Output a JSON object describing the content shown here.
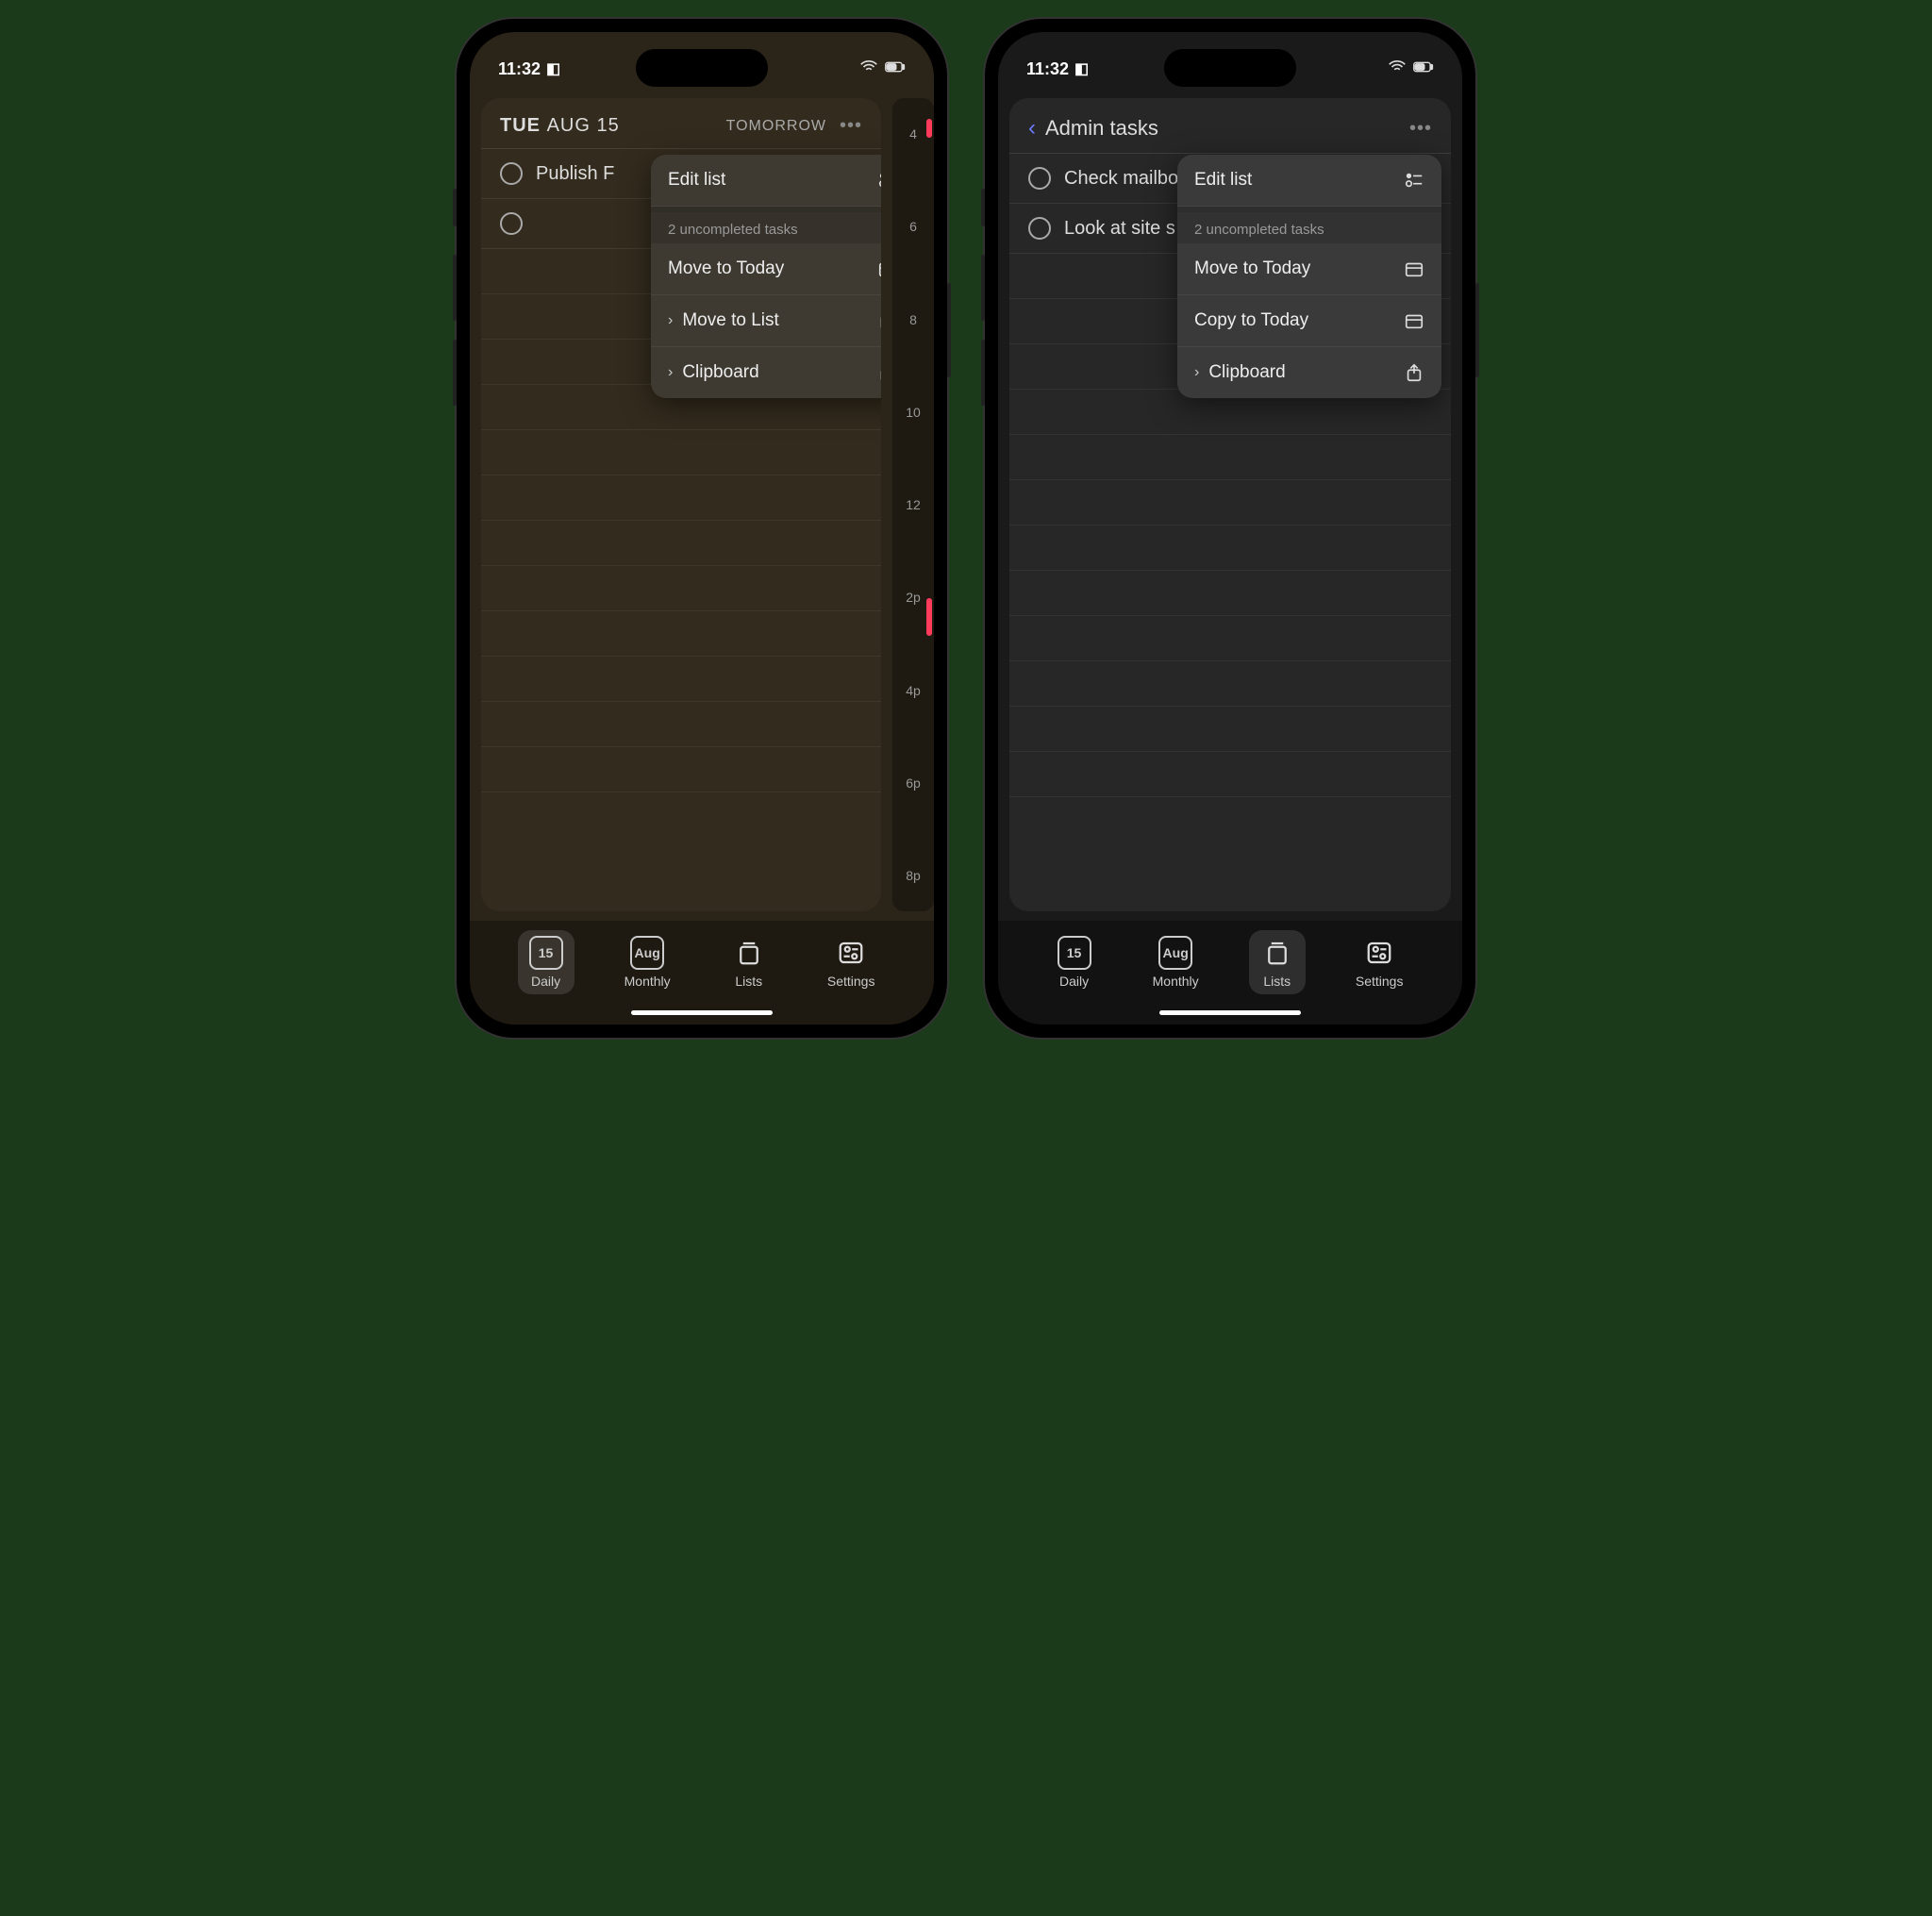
{
  "status": {
    "time": "11:32"
  },
  "left": {
    "header": {
      "day": "TUE",
      "date": "AUG 15",
      "tomorrow": "TOMORROW"
    },
    "tasks": [
      {
        "label": "Publish F"
      },
      {
        "label": ""
      }
    ],
    "timeline": [
      "4",
      "6",
      "8",
      "10",
      "12",
      "2p",
      "4p",
      "6p",
      "8p"
    ],
    "menu": {
      "edit": "Edit list",
      "subheader": "2 uncompleted tasks",
      "moveToday": "Move to Today",
      "moveList": "Move to List",
      "clipboard": "Clipboard"
    }
  },
  "right": {
    "header": {
      "title": "Admin tasks"
    },
    "tasks": [
      {
        "label": "Check mailbo"
      },
      {
        "label": "Look at site s"
      }
    ],
    "menu": {
      "edit": "Edit list",
      "subheader": "2 uncompleted tasks",
      "moveToday": "Move to Today",
      "copyToday": "Copy to Today",
      "clipboard": "Clipboard"
    }
  },
  "tabs": {
    "daily": {
      "label": "Daily",
      "badge": "15"
    },
    "monthly": {
      "label": "Monthly",
      "badge": "Aug"
    },
    "lists": {
      "label": "Lists"
    },
    "settings": {
      "label": "Settings"
    }
  }
}
